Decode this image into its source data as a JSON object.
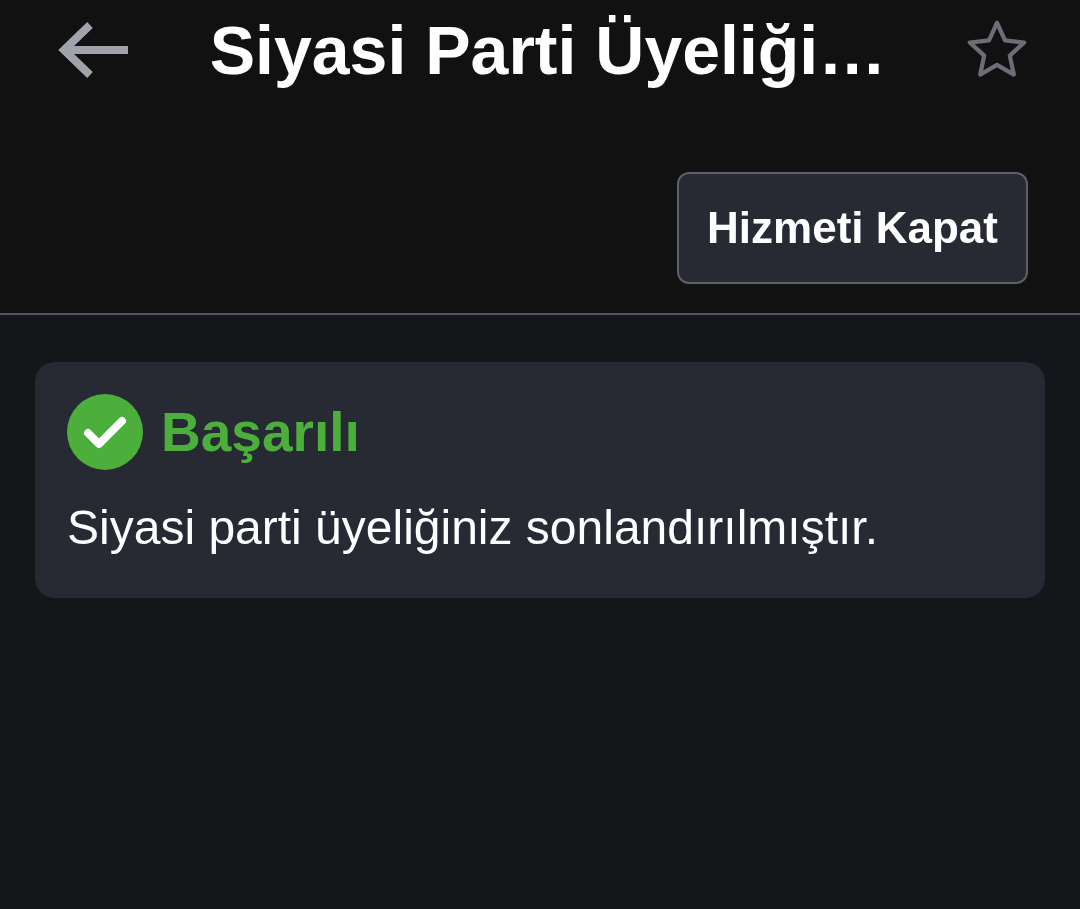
{
  "header": {
    "title": "Siyasi Parti Üyeliği…",
    "favorite": false
  },
  "actions": [
    {
      "label": "Hizmeti Kapat"
    }
  ],
  "alert": {
    "kind": "success",
    "title": "Başarılı",
    "message": "Siyasi parti üyeliğiniz sonlandırılmıştır."
  }
}
